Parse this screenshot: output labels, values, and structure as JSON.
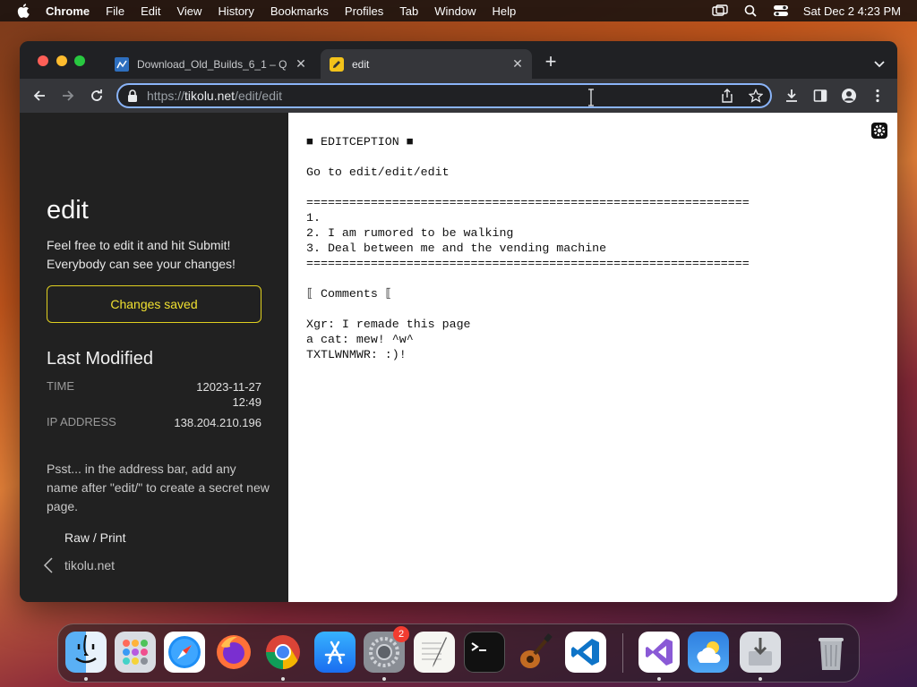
{
  "menubar": {
    "app_name": "Chrome",
    "menus": [
      "File",
      "Edit",
      "View",
      "History",
      "Bookmarks",
      "Profiles",
      "Tab",
      "Window",
      "Help"
    ],
    "clock": "Sat Dec 2  4:23 PM"
  },
  "browser": {
    "tabs": [
      {
        "title": "Download_Old_Builds_6_1 – Q",
        "icon": "spreadsheet-icon",
        "active": false
      },
      {
        "title": "edit",
        "icon": "pencil-icon",
        "active": true
      }
    ],
    "address": {
      "scheme": "https://",
      "host": "tikolu.net",
      "path": "/edit/edit"
    }
  },
  "sidebar": {
    "title": "edit",
    "intro": "Feel free to edit it and hit Submit! Everybody can see your changes!",
    "status_button": "Changes saved",
    "last_modified_heading": "Last Modified",
    "time_label": "TIME",
    "time_value_date": "12023-11-27",
    "time_value_clock": "12:49",
    "ip_label": "IP ADDRESS",
    "ip_value": "138.204.210.196",
    "tip": "Psst... in the address bar, add any name after \"edit/\" to create a secret new page.",
    "raw_link": "Raw / Print",
    "back_link": "tikolu.net"
  },
  "editor": {
    "text": "■ EDITCEPTION ■\n\nGo to edit/edit/edit\n\n==============================================================\n1.\n2. I am rumored to be walking\n3. Deal between me and the vending machine\n==============================================================\n\n⟦ Comments ⟦\n\nXgr: I remade this page\na cat: mew! ^w^\nTXTLWNMWR: :)!"
  },
  "dock": {
    "apps": [
      "finder-icon",
      "launchpad-icon",
      "safari-icon",
      "firefox-icon",
      "chrome-icon",
      "app-store-icon",
      "system-settings-icon",
      "textedit-icon",
      "terminal-icon",
      "garageband-icon",
      "vscode-icon",
      "visual-studio-icon",
      "weather-icon",
      "installer-icon",
      "trash-icon"
    ],
    "settings_badge": "2"
  },
  "colors": {
    "accent": "#8ab4f8",
    "saved_yellow": "#f0e030",
    "sidebar_bg": "#212121"
  }
}
